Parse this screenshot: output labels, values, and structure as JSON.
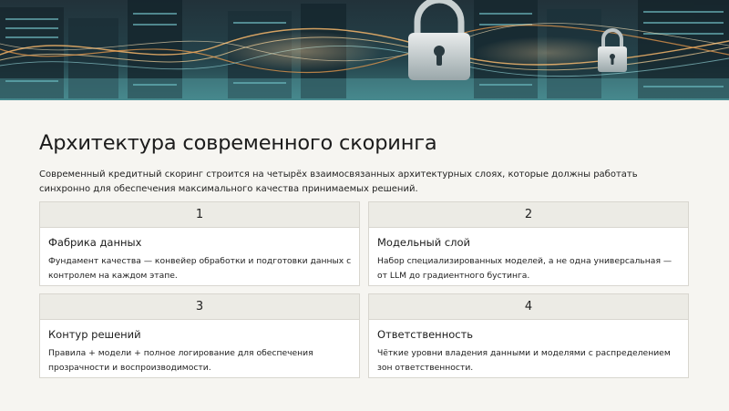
{
  "hero": {
    "image": "cybersecurity-padlocks-data-center",
    "icons": [
      "padlock-icon",
      "padlock-icon"
    ]
  },
  "page": {
    "title": "Архитектура современного скоринга",
    "intro": "Современный кредитный скоринг строится на четырёх взаимосвязанных архитектурных слоях, которые должны работать синхронно для обеспечения максимального качества принимаемых решений."
  },
  "cards": [
    {
      "number": "1",
      "title": "Фабрика данных",
      "text": "Фундамент качества — конвейер обработки и подготовки данных с контролем на каждом этапе."
    },
    {
      "number": "2",
      "title": "Модельный слой",
      "text": "Набор специализированных моделей, а не одна универсальная — от LLM до градиентного бустинга."
    },
    {
      "number": "3",
      "title": "Контур решений",
      "text": "Правила + модели + полное логирование для обеспечения прозрачности и воспроизводимости."
    },
    {
      "number": "4",
      "title": "Ответственность",
      "text": "Чёткие уровни владения данными и моделями с распределением зон ответственности."
    }
  ],
  "colors": {
    "background": "#f6f5f1",
    "card_header": "#ecebe5",
    "border": "#d8d6cf",
    "hero_teal": "#2c5a60",
    "hero_glow": "#f0b46a"
  }
}
